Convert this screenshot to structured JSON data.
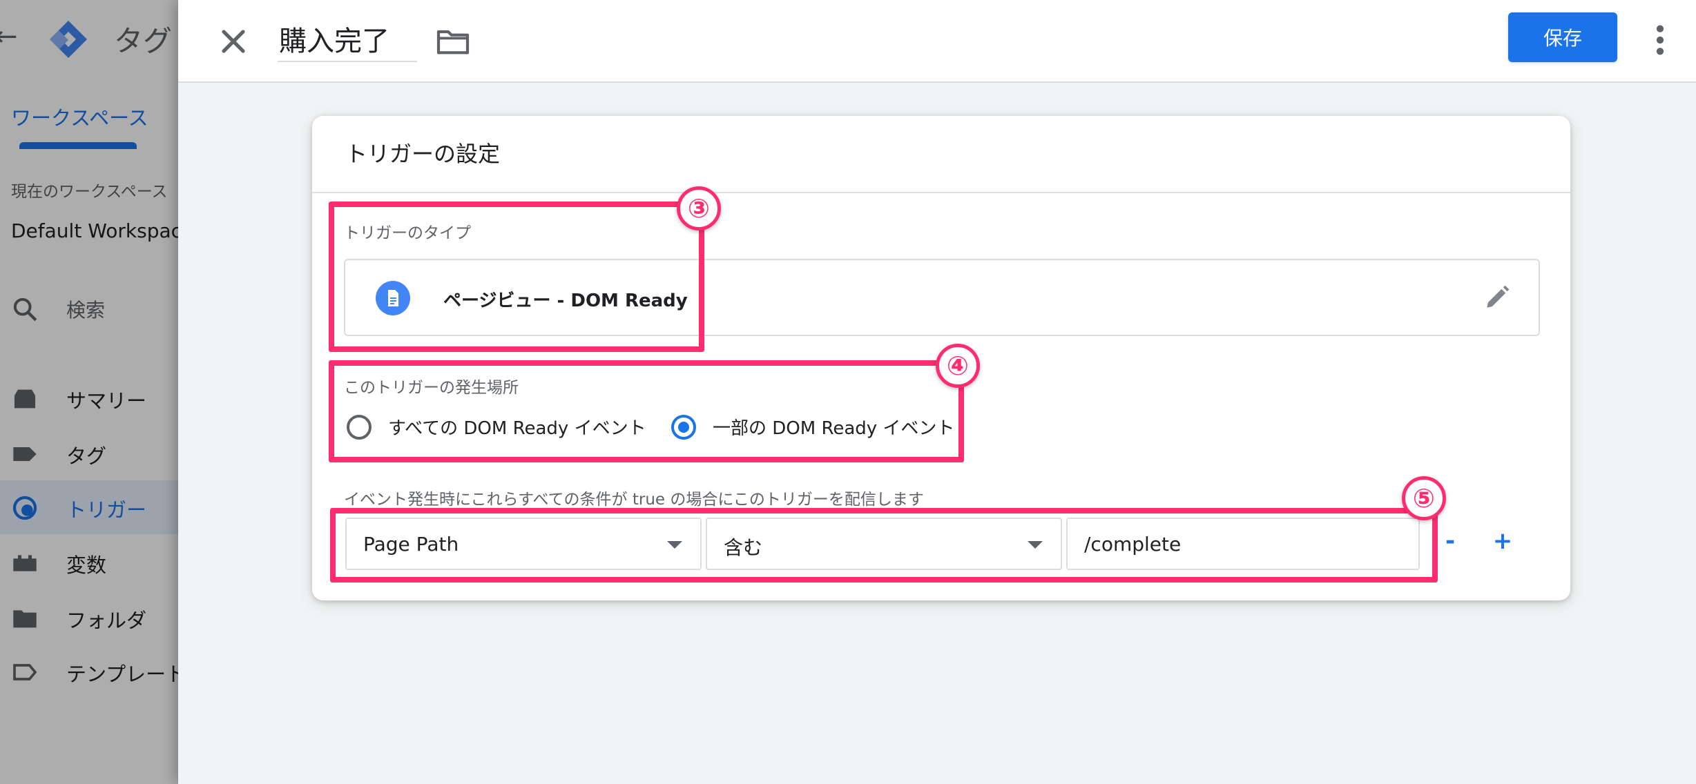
{
  "background_app": {
    "back_arrow": "←",
    "app_title": "タグ",
    "workspace_tab": "ワークスペース",
    "current_workspace_label": "現在のワークスペース",
    "workspace_name": "Default Workspace",
    "search_label": "検索",
    "nav": [
      {
        "label": "サマリー",
        "icon": "summary-icon"
      },
      {
        "label": "タグ",
        "icon": "tag-icon"
      },
      {
        "label": "トリガー",
        "icon": "trigger-icon",
        "active": true
      },
      {
        "label": "変数",
        "icon": "variable-icon"
      },
      {
        "label": "フォルダ",
        "icon": "folder-icon"
      },
      {
        "label": "テンプレート",
        "icon": "template-icon"
      }
    ]
  },
  "header": {
    "tag_name": "購入完了",
    "save_label": "保存"
  },
  "trigger_settings": {
    "title": "トリガーの設定",
    "type_label": "トリガーのタイプ",
    "type_value": "ページビュー - DOM Ready",
    "occurs_label": "このトリガーの発生場所",
    "options": [
      "すべての DOM Ready イベント",
      "一部の DOM Ready イベント"
    ],
    "selected_option": "一部の DOM Ready イベント",
    "condition_label": "イベント発生時にこれらすべての条件が true の場合にこのトリガーを配信します",
    "condition": {
      "variable": "Page Path",
      "operator": "含む",
      "value": "/complete"
    },
    "remove_label": "-",
    "add_label": "+"
  },
  "annotations": [
    "③",
    "④",
    "⑤"
  ],
  "colors": {
    "accent": "#1a73e8",
    "highlight": "#ff2d6f"
  }
}
